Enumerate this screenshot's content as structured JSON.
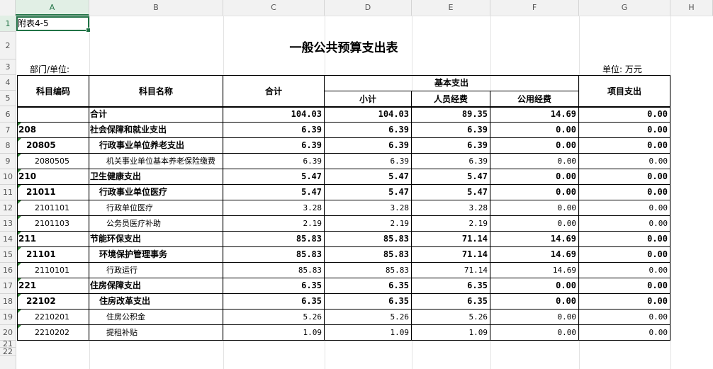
{
  "columns": [
    "A",
    "B",
    "C",
    "D",
    "E",
    "F",
    "G",
    "H"
  ],
  "rows": [
    "1",
    "2",
    "3",
    "4",
    "5",
    "6",
    "7",
    "8",
    "9",
    "10",
    "11",
    "12",
    "13",
    "14",
    "15",
    "16",
    "17",
    "18",
    "19",
    "20",
    "21",
    "22"
  ],
  "a1": "附表4-5",
  "title": "一般公共预算支出表",
  "dept_label": "部门/单位:",
  "unit_label": "单位: 万元",
  "headers": {
    "code": "科目编码",
    "name": "科目名称",
    "total": "合计",
    "basic": "基本支出",
    "subtotal": "小计",
    "personnel": "人员经费",
    "public": "公用经费",
    "project": "项目支出"
  },
  "table": [
    {
      "code": "",
      "name": "合计",
      "total": "104.03",
      "sub": "104.03",
      "per": "89.35",
      "pub": "14.69",
      "proj": "0.00",
      "level": 0
    },
    {
      "code": "208",
      "name": "社会保障和就业支出",
      "total": "6.39",
      "sub": "6.39",
      "per": "6.39",
      "pub": "0.00",
      "proj": "0.00",
      "level": 1
    },
    {
      "code": "20805",
      "name": "行政事业单位养老支出",
      "total": "6.39",
      "sub": "6.39",
      "per": "6.39",
      "pub": "0.00",
      "proj": "0.00",
      "level": 2
    },
    {
      "code": "2080505",
      "name": "机关事业单位基本养老保险缴费",
      "total": "6.39",
      "sub": "6.39",
      "per": "6.39",
      "pub": "0.00",
      "proj": "0.00",
      "level": 3
    },
    {
      "code": "210",
      "name": "卫生健康支出",
      "total": "5.47",
      "sub": "5.47",
      "per": "5.47",
      "pub": "0.00",
      "proj": "0.00",
      "level": 1
    },
    {
      "code": "21011",
      "name": "行政事业单位医疗",
      "total": "5.47",
      "sub": "5.47",
      "per": "5.47",
      "pub": "0.00",
      "proj": "0.00",
      "level": 2
    },
    {
      "code": "2101101",
      "name": "行政单位医疗",
      "total": "3.28",
      "sub": "3.28",
      "per": "3.28",
      "pub": "0.00",
      "proj": "0.00",
      "level": 3
    },
    {
      "code": "2101103",
      "name": "公务员医疗补助",
      "total": "2.19",
      "sub": "2.19",
      "per": "2.19",
      "pub": "0.00",
      "proj": "0.00",
      "level": 3
    },
    {
      "code": "211",
      "name": "节能环保支出",
      "total": "85.83",
      "sub": "85.83",
      "per": "71.14",
      "pub": "14.69",
      "proj": "0.00",
      "level": 1
    },
    {
      "code": "21101",
      "name": "环境保护管理事务",
      "total": "85.83",
      "sub": "85.83",
      "per": "71.14",
      "pub": "14.69",
      "proj": "0.00",
      "level": 2
    },
    {
      "code": "2110101",
      "name": "行政运行",
      "total": "85.83",
      "sub": "85.83",
      "per": "71.14",
      "pub": "14.69",
      "proj": "0.00",
      "level": 3
    },
    {
      "code": "221",
      "name": "住房保障支出",
      "total": "6.35",
      "sub": "6.35",
      "per": "6.35",
      "pub": "0.00",
      "proj": "0.00",
      "level": 1
    },
    {
      "code": "22102",
      "name": "住房改革支出",
      "total": "6.35",
      "sub": "6.35",
      "per": "6.35",
      "pub": "0.00",
      "proj": "0.00",
      "level": 2
    },
    {
      "code": "2210201",
      "name": "住房公积金",
      "total": "5.26",
      "sub": "5.26",
      "per": "5.26",
      "pub": "0.00",
      "proj": "0.00",
      "level": 3
    },
    {
      "code": "2210202",
      "name": "提租补贴",
      "total": "1.09",
      "sub": "1.09",
      "per": "1.09",
      "pub": "0.00",
      "proj": "0.00",
      "level": 3
    }
  ]
}
